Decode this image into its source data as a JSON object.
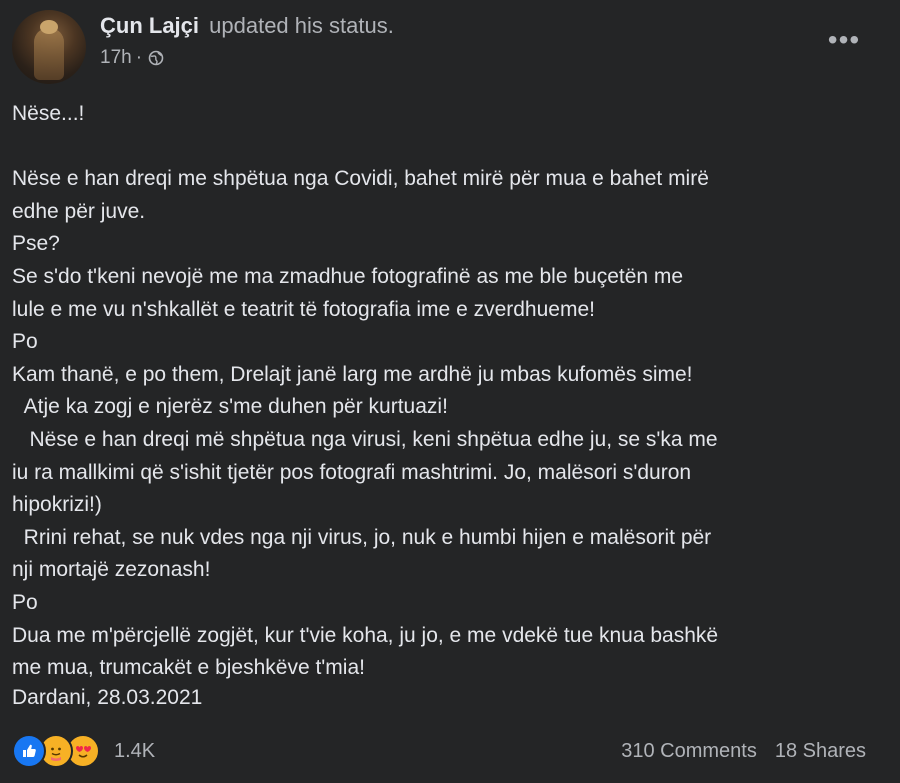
{
  "post": {
    "author": "Çun Lajçi",
    "action": "updated his status.",
    "time": "17h",
    "separator": "·",
    "privacy_icon": "public-globe-icon",
    "more_label": "•••",
    "text": "Nëse...!\n\nNëse e han dreqi me shpëtua nga Covidi, bahet mirë për mua e bahet mirë\nedhe për juve.\nPse?\nSe s'do t'keni nevojë me ma zmadhue fotografinë as me ble buçetën me\nlule e me vu n'shkallët e teatrit të fotografia ime e zverdhueme!\nPo\nKam thanë, e po them, Drelajt janë larg me ardhë ju mbas kufomës sime!\n  Atje ka zogj e njerëz s'me duhen për kurtuazi!\n   Nëse e han dreqi më shpëtua nga virusi, keni shpëtua edhe ju, se s'ka me\niu ra mallkimi që s'ishit tjetër pos fotografi mashtrimi. Jo, malësori s'duron\nhipokrizi!)\n  Rrini rehat, se nuk vdes nga nji virus, jo, nuk e humbi hijen e malësorit për\nnji mortajë zezonash!\nPo\nDua me m'përcjellë zogjët, kur t'vie koha, ju jo, e me vdekë tue knua bashkë\nme mua, trumcakët e bjeshkëve t'mia!",
    "signature": "Dardani, 28.03.2021"
  },
  "footer": {
    "reaction_icons": [
      "like-icon",
      "care-icon",
      "love-face-icon"
    ],
    "reaction_count": "1.4K",
    "comments": "310 Comments",
    "shares": "18 Shares"
  },
  "colors": {
    "background": "#242526",
    "text_primary": "#e4e6eb",
    "text_secondary": "#b0b3b8",
    "like_blue": "#1877f2",
    "reaction_yellow": "#f7b125"
  }
}
